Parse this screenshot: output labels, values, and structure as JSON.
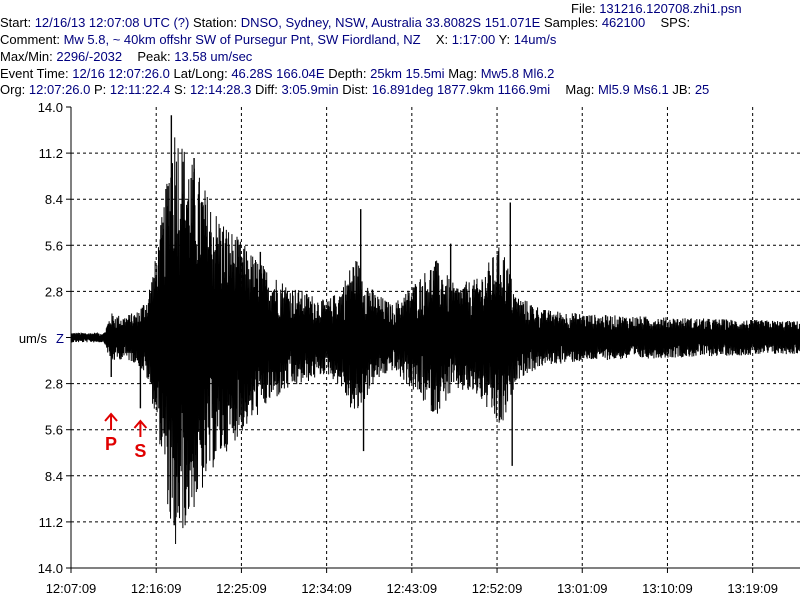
{
  "header": {
    "file_label": "File:",
    "file": "131216.120708.zhi1.psn",
    "start_label": "Start:",
    "start": "12/16/13 12:07:08 UTC (?)",
    "station_label": "Station:",
    "station": "DNSO, Sydney, NSW, Australia 33.8082S 151.071E",
    "samples_label": "Samples:",
    "samples": "462100",
    "sps_label": "SPS:",
    "comment_label": "Comment:",
    "comment": "Mw 5.8, ~ 40km offshr SW of Pursegur Pnt, SW Fiordland, NZ",
    "x_label": "X:",
    "x_value": "1:17:00",
    "y_label": "Y:",
    "y_value": "14um/s",
    "maxmin_label": "Max/Min:",
    "maxmin": "2296/-2032",
    "peak_label": "Peak:",
    "peak": "13.58 um/sec",
    "event_time_label": "Event Time:",
    "event_time": "12/16 12:07:26.0",
    "latlong_label": "Lat/Long:",
    "latlong": "46.28S 166.04E",
    "depth_label": "Depth:",
    "depth": "25km 15.5mi",
    "mag_label": "Mag:",
    "mag": "Mw5.8 Ml6.2",
    "org_label": "Org:",
    "org": "12:07:26.0",
    "p_label": "P:",
    "p_time": "12:11:22.4",
    "s_label": "S:",
    "s_time": "12:14:28.3",
    "diff_label": "Diff:",
    "diff": "3:05.9min",
    "dist_label": "Dist:",
    "dist": "16.891deg 1877.9km 1166.9mi",
    "mag2_label": "Mag:",
    "mag2": "Ml5.9 Ms6.1",
    "jb_label": "JB:",
    "jb": "25"
  },
  "chart_data": {
    "type": "line",
    "series": [
      {
        "name": "Z"
      }
    ],
    "ylabel": "um/s",
    "channel": "Z",
    "ylim": [
      -14.0,
      14.0
    ],
    "y_tick_labels": [
      "14.0",
      "11.2",
      "8.4",
      "5.6",
      "2.8",
      "",
      "2.8",
      "5.6",
      "8.4",
      "11.2",
      "14.0"
    ],
    "x_tick_labels": [
      "12:07:09",
      "12:16:09",
      "12:25:09",
      "12:34:09",
      "12:43:09",
      "12:52:09",
      "13:01:09",
      "13:10:09",
      "13:19:09"
    ],
    "x_range_minutes": [
      0,
      77
    ],
    "x_tick_step_minutes": 9,
    "grid": true,
    "phase_markers": [
      {
        "label": "P",
        "minute": 4.23
      },
      {
        "label": "S",
        "minute": 7.33
      }
    ],
    "envelope": {
      "minute": [
        0,
        3.5,
        4.2,
        5.5,
        7.0,
        8.0,
        9.0,
        10.0,
        10.8,
        11.8,
        12.5,
        13.5,
        15.0,
        17.0,
        19.0,
        21.0,
        23.0,
        25.5,
        27.0,
        28.5,
        30.0,
        32.0,
        34.0,
        37.0,
        38.5,
        40.5,
        43.0,
        45.5,
        47.0,
        50.0,
        55.0,
        60.0,
        65.0,
        70.0,
        77.0
      ],
      "amplitude": [
        0.3,
        0.3,
        1.5,
        1.3,
        1.6,
        2.5,
        5.0,
        9.0,
        13.5,
        12.0,
        11.0,
        10.0,
        8.0,
        6.5,
        5.2,
        4.0,
        3.2,
        2.6,
        2.2,
        3.0,
        5.0,
        2.8,
        2.0,
        3.8,
        4.8,
        3.2,
        3.6,
        5.8,
        2.6,
        1.7,
        1.4,
        1.3,
        1.2,
        1.1,
        1.0
      ]
    },
    "spikes": [
      {
        "minute": 4.25,
        "value": -2.4
      },
      {
        "minute": 7.33,
        "value": -4.3
      },
      {
        "minute": 9.3,
        "value": 5.3
      },
      {
        "minute": 10.6,
        "value": 13.5
      },
      {
        "minute": 10.9,
        "value": -11.4
      },
      {
        "minute": 12.1,
        "value": -10.8
      },
      {
        "minute": 13.0,
        "value": 10.9
      },
      {
        "minute": 14.0,
        "value": -7.9
      },
      {
        "minute": 16.5,
        "value": -6.5
      },
      {
        "minute": 20.0,
        "value": 5.2
      },
      {
        "minute": 30.6,
        "value": 7.8
      },
      {
        "minute": 30.9,
        "value": -6.9
      },
      {
        "minute": 38.2,
        "value": -4.5
      },
      {
        "minute": 39.4,
        "value": 2.6
      },
      {
        "minute": 40.1,
        "value": 5.7
      },
      {
        "minute": 46.4,
        "value": 8.2
      },
      {
        "minute": 46.6,
        "value": -7.8
      }
    ]
  }
}
